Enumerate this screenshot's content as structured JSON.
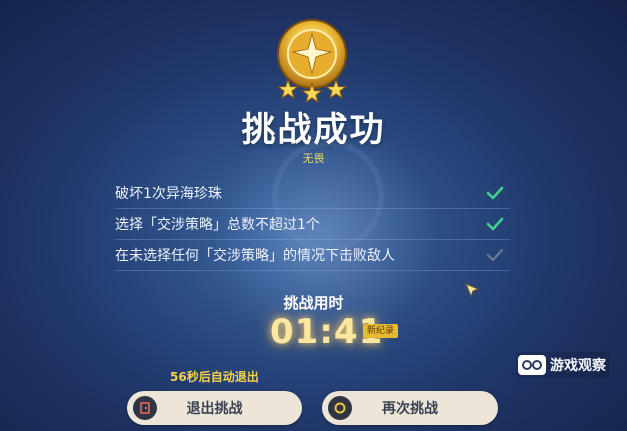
{
  "header": {
    "title": "挑战成功",
    "subtitle": "无畏",
    "stars_earned": 3,
    "stars_total": 3
  },
  "criteria": [
    {
      "text": "破坏1次异海珍珠",
      "completed": true
    },
    {
      "text": "选择「交涉策略」总数不超过1个",
      "completed": true
    },
    {
      "text": "在未选择任何「交涉策略」的情况下击败敌人",
      "completed": false
    }
  ],
  "timer": {
    "label": "挑战用时",
    "value": "01:41",
    "badge": "新纪录"
  },
  "footer": {
    "auto_exit": "56秒后自动退出",
    "exit_label": "退出挑战",
    "retry_label": "再次挑战"
  },
  "watermark": {
    "text": "游戏观察"
  },
  "colors": {
    "check_complete": "#3fd08a",
    "check_incomplete": "#6b7a96",
    "gold": "#f3d34a",
    "button_bg": "#ece5d8"
  }
}
